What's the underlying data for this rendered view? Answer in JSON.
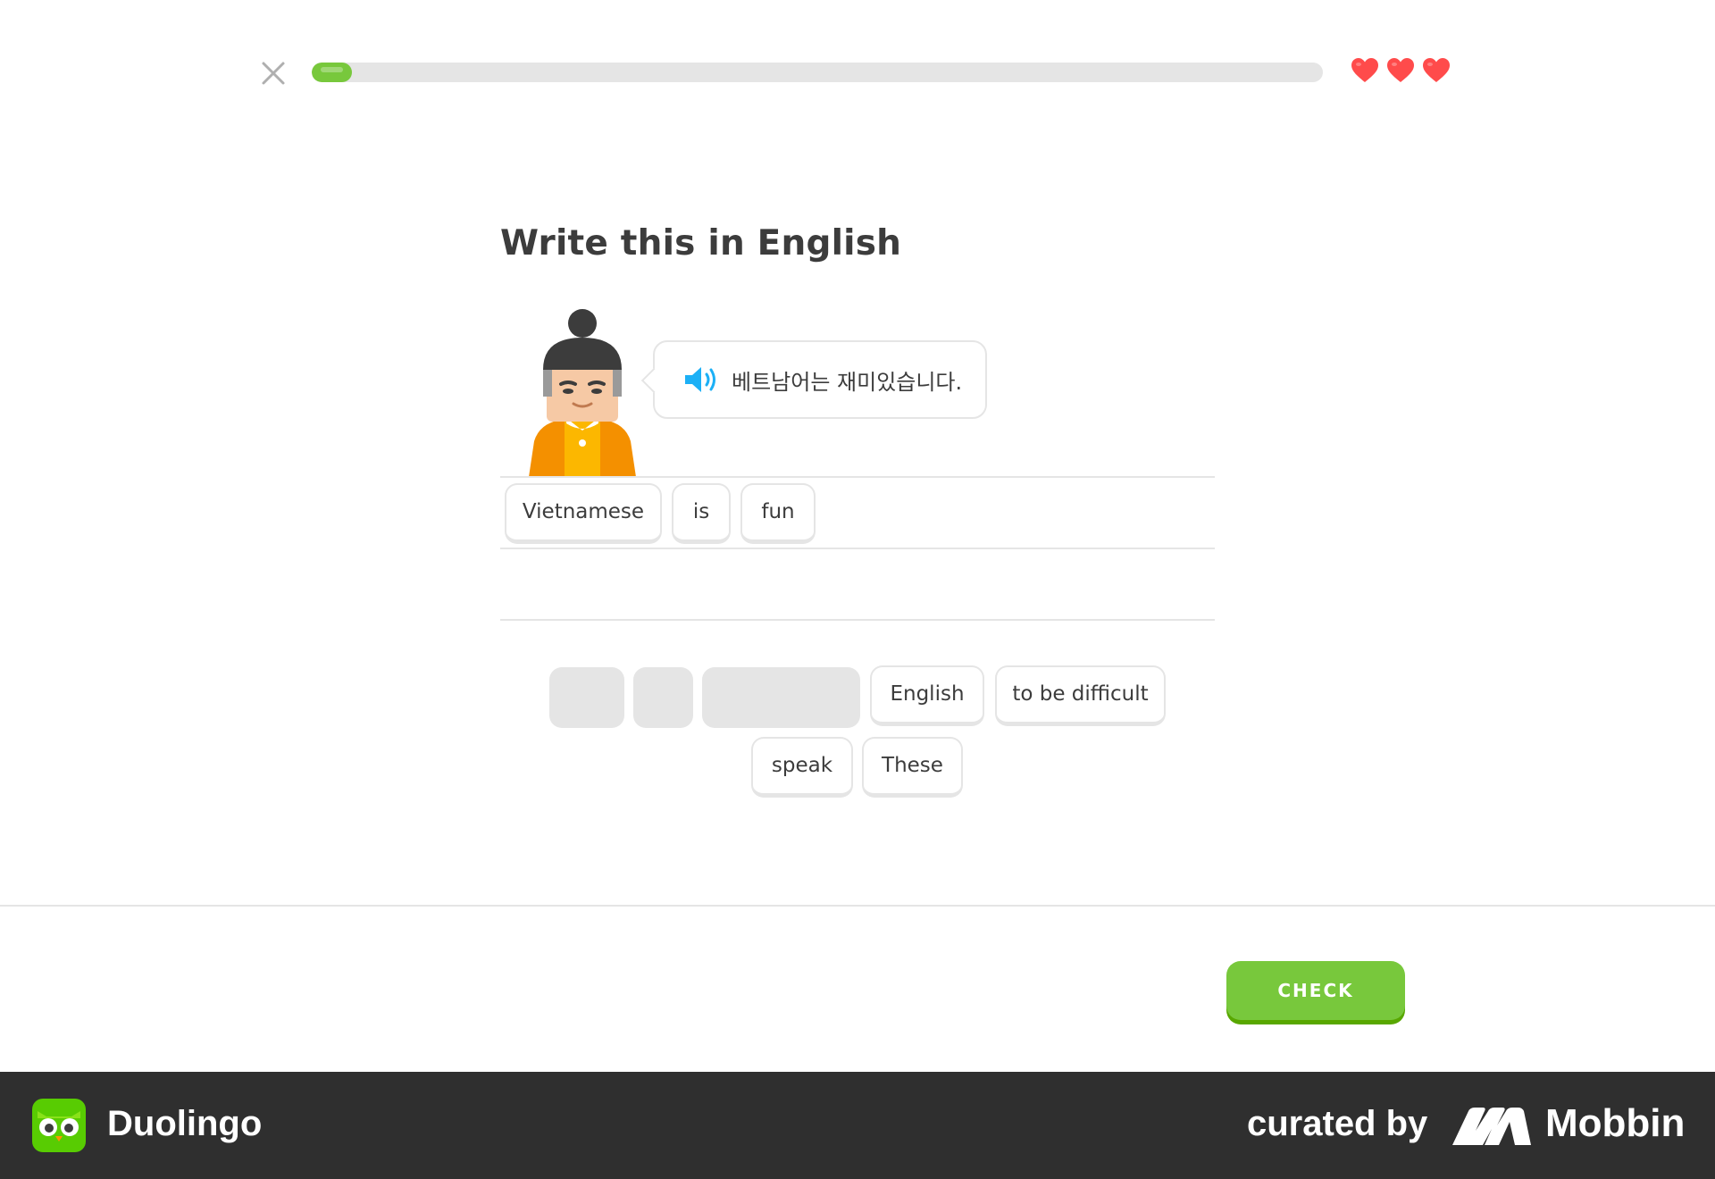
{
  "header": {
    "close_icon": "close-icon",
    "progress_fraction": 0.04,
    "hearts": [
      "heart-icon",
      "heart-icon",
      "heart-icon"
    ],
    "accent_color": "#78c83c",
    "heart_color": "#ff4b4b"
  },
  "exercise": {
    "title": "Write this in English",
    "prompt_text": "베트남어는 재미있습니다.",
    "speaker_icon": "speaker-icon",
    "character": "character-avatar"
  },
  "answer": {
    "selected_words": [
      "Vietnamese",
      "is",
      "fun"
    ]
  },
  "word_bank": {
    "row1": [
      "English",
      "to be difficult"
    ],
    "row2": [
      "speak",
      "These"
    ]
  },
  "footer": {
    "check_label": "CHECK"
  },
  "brand_bar": {
    "app_name": "Duolingo",
    "curated_label": "curated by",
    "curator_name": "Mobbin"
  }
}
